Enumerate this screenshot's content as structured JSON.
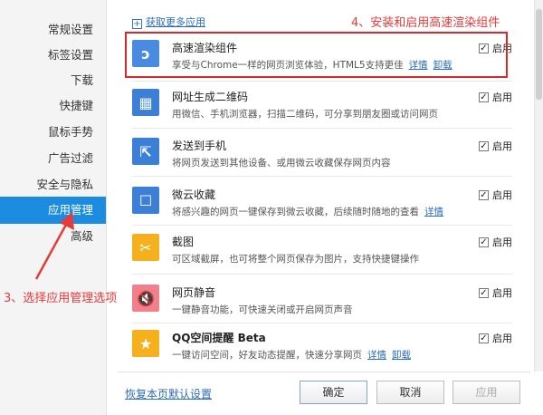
{
  "sidebar": {
    "items": [
      {
        "label": "常规设置"
      },
      {
        "label": "标签设置"
      },
      {
        "label": "下载"
      },
      {
        "label": "快捷键"
      },
      {
        "label": "鼠标手势"
      },
      {
        "label": "广告过滤"
      },
      {
        "label": "安全与隐私"
      },
      {
        "label": "应用管理",
        "active": true
      },
      {
        "label": "高级"
      }
    ]
  },
  "main": {
    "get_more_label": "获取更多应用",
    "plugins": [
      {
        "title": "高速渲染组件",
        "desc": "享受与Chrome一样的网页浏览体验，HTML5支持更佳",
        "link1": "详情",
        "link2": "卸载",
        "enabled": true,
        "enable_label": "启用",
        "icon": "chrome-swirl-icon",
        "icon_glyph": "ↄ",
        "icon_color": "#4a8be2"
      },
      {
        "title": "网址生成二维码",
        "desc": "用微信、手机浏览器，扫描二维码，可分享到朋友圈或访问网页",
        "enabled": true,
        "enable_label": "启用",
        "icon": "qr-code-icon",
        "icon_glyph": "▦",
        "icon_color": "#3b7fd6"
      },
      {
        "title": "发送到手机",
        "desc": "将网页发送到其他设备、或用微云收藏保存网页内容",
        "enabled": true,
        "enable_label": "启用",
        "icon": "share-to-phone-icon",
        "icon_glyph": "⇱",
        "icon_color": "#3b7fd6"
      },
      {
        "title": "微云收藏",
        "desc": "将感兴趣的网页一键保存到微云收藏，后续随时随地的查看",
        "link1": "详情",
        "enabled": true,
        "enable_label": "启用",
        "icon": "cloud-collect-icon",
        "icon_glyph": "☐",
        "icon_color": "#3b7fd6"
      },
      {
        "title": "截图",
        "desc": "可区域截屏，也可将整个网页保存为图片，支持快捷键操作",
        "enabled": true,
        "enable_label": "启用",
        "icon": "scissors-icon",
        "icon_glyph": "✂",
        "icon_color": "#f5b11d"
      },
      {
        "title": "网页静音",
        "desc": "一键静音功能，可快速关闭或开启网页声音",
        "enabled": true,
        "enable_label": "启用",
        "icon": "speaker-mute-icon",
        "icon_glyph": "🔇",
        "icon_color": "#f0808c"
      },
      {
        "title": "QQ空间提醒 Beta",
        "desc": "一键访问空间，好友动态提醒，快速分享网页",
        "link1": "详情",
        "link2": "卸载",
        "enabled": true,
        "enable_label": "启用",
        "icon": "star-icon",
        "icon_glyph": "★",
        "icon_color": "#f5b11d"
      }
    ]
  },
  "annotations": {
    "top": "4、安装和启用高速渲染组件",
    "left": "3、选择应用管理选项"
  },
  "footer": {
    "restore_label": "恢复本页默认设置",
    "ok_label": "确定",
    "cancel_label": "取消",
    "apply_label": "应用"
  },
  "colors": {
    "accent": "#1b8ce0",
    "annotation": "#e43b3b"
  }
}
